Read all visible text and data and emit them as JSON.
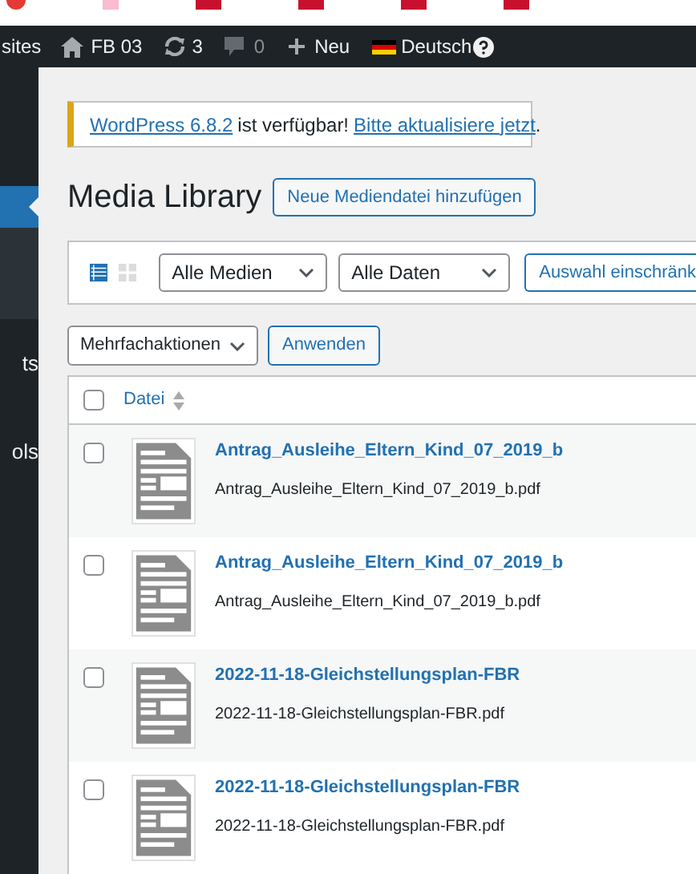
{
  "admin_bar": {
    "sites": "sites",
    "site": "FB 03",
    "updates": "3",
    "comments": "0",
    "new": "Neu",
    "language": "Deutsch"
  },
  "sidebar": {
    "items": [
      {
        "selected": true
      },
      {
        "label": "ts",
        "selected": false
      },
      {
        "label": "ols",
        "selected": false
      }
    ]
  },
  "notice": {
    "version_link": "WordPress 6.8.2",
    "text": "ist verfügbar!",
    "update_link": "Bitte aktualisiere jetzt",
    "end": "."
  },
  "page": {
    "title": "Media Library",
    "add_button": "Neue Mediendatei hinzufügen"
  },
  "filters": {
    "views": [
      {
        "kind": "list",
        "selected": true
      },
      {
        "kind": "grid",
        "selected": false
      }
    ],
    "type": "Alle Medien",
    "date": "Alle Daten",
    "button": "Auswahl einschränk"
  },
  "bulk": {
    "action": "Mehrfachaktionen",
    "apply": "Anwenden"
  },
  "table": {
    "all_checked": false,
    "column": "Datei",
    "rows": [
      {
        "title": "Antrag_Ausleihe_Eltern_Kind_07_2019_b",
        "file": "Antrag_Ausleihe_Eltern_Kind_07_2019_b.pdf",
        "checked": false
      },
      {
        "title": "Antrag_Ausleihe_Eltern_Kind_07_2019_b",
        "file": "Antrag_Ausleihe_Eltern_Kind_07_2019_b.pdf",
        "checked": false
      },
      {
        "title": "2022-11-18-Gleichstellungsplan-FBR",
        "file": "2022-11-18-Gleichstellungsplan-FBR.pdf",
        "checked": false
      },
      {
        "title": "2022-11-18-Gleichstellungsplan-FBR",
        "file": "2022-11-18-Gleichstellungsplan-FBR.pdf",
        "checked": false
      }
    ]
  }
}
